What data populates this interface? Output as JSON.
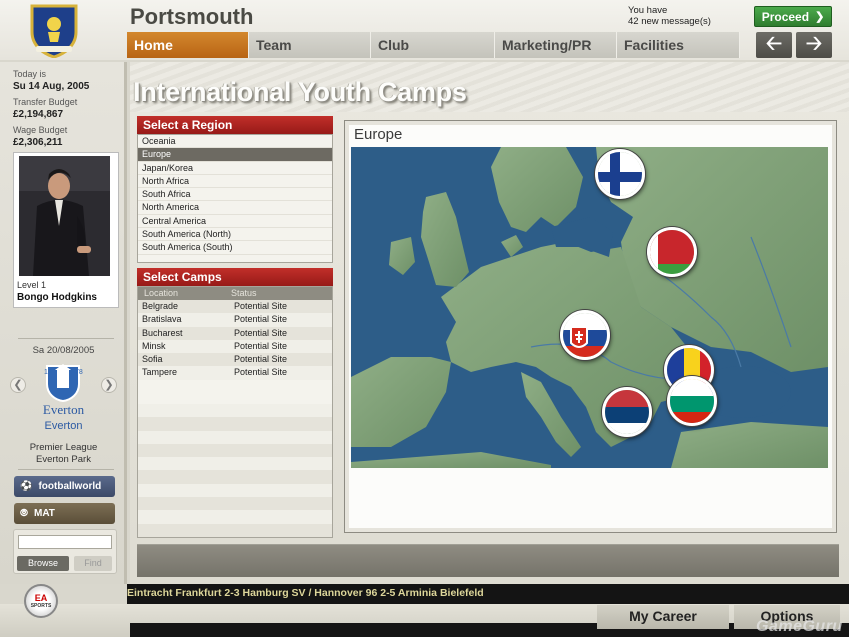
{
  "header": {
    "club_name": "Portsmouth",
    "messages_line1": "You have",
    "messages_line2": "42 new message(s)",
    "proceed_label": "Proceed",
    "tabs": [
      {
        "label": "Home",
        "active": true
      },
      {
        "label": "Team",
        "active": false
      },
      {
        "label": "Club",
        "active": false
      },
      {
        "label": "Marketing/PR",
        "active": false
      },
      {
        "label": "Facilities",
        "active": false
      }
    ],
    "back_icon": "arrow-left-icon",
    "forward_icon": "arrow-right-icon"
  },
  "sidebar": {
    "today_label": "Today is",
    "today_value": "Su 14 Aug, 2005",
    "transfer_label": "Transfer Budget",
    "transfer_value": "£2,194,867",
    "wage_label": "Wage Budget",
    "wage_value": "£2,306,211",
    "manager_level": "Level 1",
    "manager_name": "Bongo Hodgkins",
    "fixture_date": "Sa 20/08/2005",
    "opponent_crest_text": "Everton",
    "opponent": "Everton",
    "competition": "Premier League",
    "stadium": "Everton Park",
    "footballworld_label": "footballworld",
    "mat_label": "MAT",
    "search_value": "",
    "browse_label": "Browse",
    "find_label": "Find"
  },
  "main": {
    "title": "International Youth Camps",
    "region_header": "Select a Region",
    "regions": [
      {
        "label": "Oceania",
        "selected": false
      },
      {
        "label": "Europe",
        "selected": true
      },
      {
        "label": "Japan/Korea",
        "selected": false
      },
      {
        "label": "North Africa",
        "selected": false
      },
      {
        "label": "South Africa",
        "selected": false
      },
      {
        "label": "North America",
        "selected": false
      },
      {
        "label": "Central America",
        "selected": false
      },
      {
        "label": "South America (North)",
        "selected": false
      },
      {
        "label": "South America (South)",
        "selected": false
      }
    ],
    "camps_header": "Select Camps",
    "camps_columns": [
      "Location",
      "Status"
    ],
    "camps": [
      {
        "location": "Belgrade",
        "status": "Potential Site"
      },
      {
        "location": "Bratislava",
        "status": "Potential Site"
      },
      {
        "location": "Bucharest",
        "status": "Potential Site"
      },
      {
        "location": "Minsk",
        "status": "Potential Site"
      },
      {
        "location": "Sofia",
        "status": "Potential Site"
      },
      {
        "location": "Tampere",
        "status": "Potential Site"
      }
    ],
    "map_title": "Europe",
    "map_flags": [
      "finland-flag",
      "belarus-flag",
      "slovakia-flag",
      "romania-flag",
      "serbia-flag",
      "bulgaria-flag"
    ]
  },
  "footer": {
    "ticker": "Eintracht Frankfurt 2-3 Hamburg SV   /   Hannover 96 2-5 Arminia Bielefeld",
    "my_career_label": "My Career",
    "options_label": "Options",
    "watermark": "GameGuru",
    "logo_text": "EA",
    "logo_subtext": "SPORTS"
  },
  "colors": {
    "active_tab": "#d3872d",
    "proceed_green": "#3a913a",
    "panel_red": "#b0231f",
    "sea_blue": "#2d5d88",
    "land_green": "#7fa07a"
  }
}
